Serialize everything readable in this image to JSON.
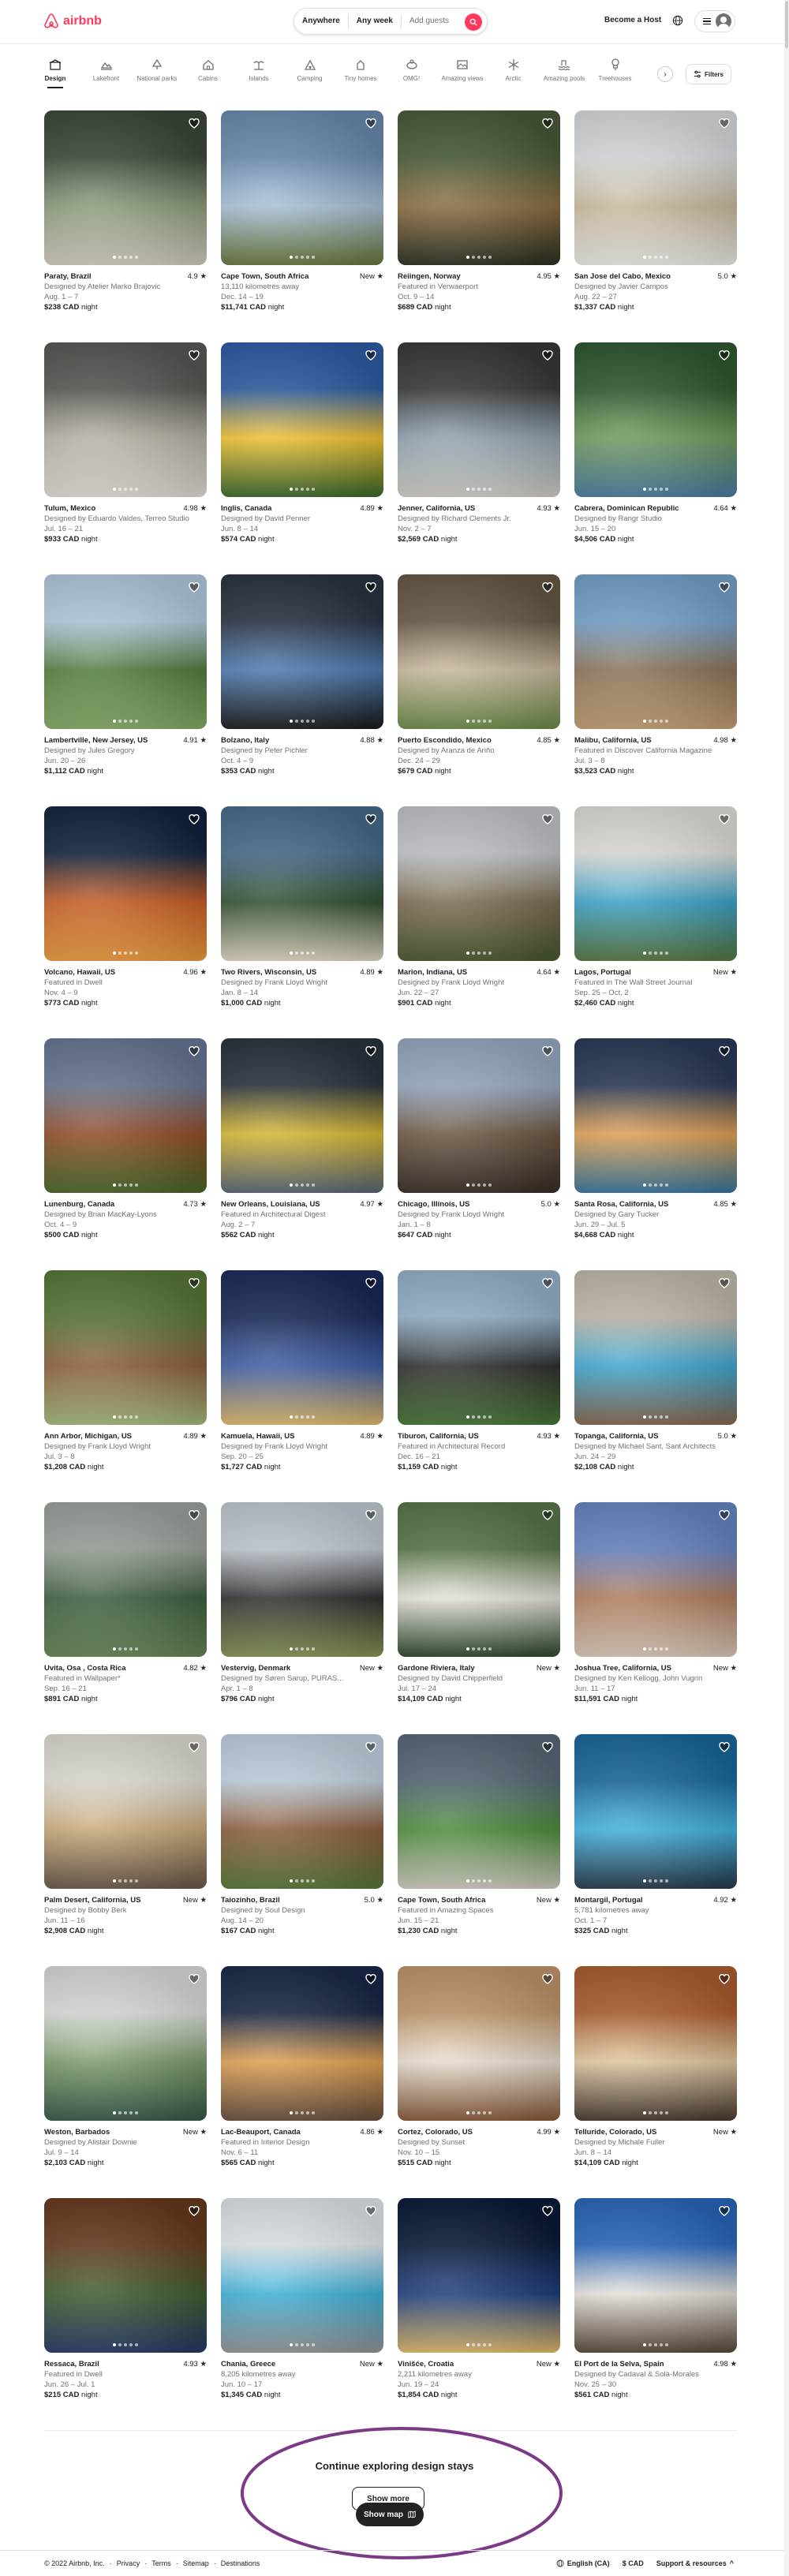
{
  "header": {
    "brand": "airbnb",
    "search": {
      "where": "Anywhere",
      "when": "Any week",
      "who": "Add guests"
    },
    "host_link": "Become a Host"
  },
  "categories": [
    {
      "label": "Design",
      "icon": "design-icon",
      "active": true
    },
    {
      "label": "Lakefront",
      "icon": "lakefront-icon"
    },
    {
      "label": "National parks",
      "icon": "national-parks-icon"
    },
    {
      "label": "Cabins",
      "icon": "cabin-icon"
    },
    {
      "label": "Islands",
      "icon": "island-icon"
    },
    {
      "label": "Camping",
      "icon": "camping-icon"
    },
    {
      "label": "Tiny homes",
      "icon": "tiny-home-icon"
    },
    {
      "label": "OMG!",
      "icon": "omg-icon"
    },
    {
      "label": "Amazing views",
      "icon": "amazing-views-icon"
    },
    {
      "label": "Arctic",
      "icon": "arctic-icon"
    },
    {
      "label": "Amazing pools",
      "icon": "pool-icon"
    },
    {
      "label": "Treehouses",
      "icon": "treehouse-icon"
    }
  ],
  "filters_label": "Filters",
  "listings": [
    {
      "location": "Paraty, Brazil",
      "rating": "4.9 ★",
      "sub": "Designed by Atelier Marko Brajovic",
      "dates": "Aug. 1 – 7",
      "price": "$238 CAD",
      "unit": "night",
      "colors": [
        "#3c4a3a",
        "#8a9a7a",
        "#d9d4c4"
      ]
    },
    {
      "location": "Cape Town, South Africa",
      "rating": "New ★",
      "sub": "13,110 kilometres away",
      "dates": "Dec. 14 – 19",
      "price": "$11,741 CAD",
      "unit": "night",
      "colors": [
        "#6d8fb3",
        "#a9c1d8",
        "#6b7a3f"
      ]
    },
    {
      "location": "Reiingen, Norway",
      "rating": "4.95 ★",
      "sub": "Featured in Verwaerport",
      "dates": "Oct. 9 – 14",
      "price": "$689 CAD",
      "unit": "night",
      "colors": [
        "#4a5d3a",
        "#8a6a3e",
        "#2d3222"
      ]
    },
    {
      "location": "San Jose del Cabo, Mexico",
      "rating": "5.0 ★",
      "sub": "Designed by Javier Campos",
      "dates": "Aug. 22 – 27",
      "price": "$1,337 CAD",
      "unit": "night",
      "colors": [
        "#dfe3e6",
        "#c9b89a",
        "#f2f2f0"
      ]
    },
    {
      "location": "Tulum, Mexico",
      "rating": "4.98 ★",
      "sub": "Designed by Eduardo Valdes, Terreo Studio",
      "dates": "Jul. 16 – 21",
      "price": "$933 CAD",
      "unit": "night",
      "colors": [
        "#5a5a55",
        "#b8b2a4",
        "#e8e4dc"
      ]
    },
    {
      "location": "Inglis, Canada",
      "rating": "4.89 ★",
      "sub": "Designed by David Penner",
      "dates": "Jun. 8 – 14",
      "price": "$574 CAD",
      "unit": "night",
      "colors": [
        "#2f5ea8",
        "#f2c12e",
        "#3d6b2e"
      ]
    },
    {
      "location": "Jenner, California, US",
      "rating": "4.93 ★",
      "sub": "Designed by Richard Clements Jr.",
      "dates": "Nov. 2 – 7",
      "price": "$2,569 CAD",
      "unit": "night",
      "colors": [
        "#3a3a3a",
        "#8fa3b0",
        "#d8d4cc"
      ]
    },
    {
      "location": "Cabrera, Dominican Republic",
      "rating": "4.64 ★",
      "sub": "Designed by Rangr Studio",
      "dates": "Jun. 15 – 20",
      "price": "$4,506 CAD",
      "unit": "night",
      "colors": [
        "#2f5a30",
        "#6f9a5a",
        "#4d7fa6"
      ]
    },
    {
      "location": "Lambertville, New Jersey, US",
      "rating": "4.91 ★",
      "sub": "Designed by Jules Gregory",
      "dates": "Jun. 20 – 26",
      "price": "$1,112 CAD",
      "unit": "night",
      "colors": [
        "#b9d1e6",
        "#4f7a3a",
        "#8ab06a"
      ]
    },
    {
      "location": "Bolzano, Italy",
      "rating": "4.88 ★",
      "sub": "Designed by Peter Pichler",
      "dates": "Oct. 4 – 9",
      "price": "$353 CAD",
      "unit": "night",
      "colors": [
        "#2a3442",
        "#4a78b0",
        "#1c1c1c"
      ]
    },
    {
      "location": "Puerto Escondido, Mexico",
      "rating": "4.85 ★",
      "sub": "Designed by Aranza de Ariño",
      "dates": "Dec. 24 – 29",
      "price": "$679 CAD",
      "unit": "night",
      "colors": [
        "#6a5a48",
        "#c9b89c",
        "#6e8f4a"
      ]
    },
    {
      "location": "Malibu, California, US",
      "rating": "4.98 ★",
      "sub": "Featured in Discover California Magazine",
      "dates": "Jul. 3 – 8",
      "price": "$3,523 CAD",
      "unit": "night",
      "colors": [
        "#7aa6d0",
        "#8a7054",
        "#c9a478"
      ]
    },
    {
      "location": "Volcano, Hawaii, US",
      "rating": "4.96 ★",
      "sub": "Featured in Dwell",
      "dates": "Nov. 4 – 9",
      "price": "$773 CAD",
      "unit": "night",
      "colors": [
        "#12253f",
        "#c65a22",
        "#f0a040"
      ]
    },
    {
      "location": "Two Rivers, Wisconsin, US",
      "rating": "4.89 ★",
      "sub": "Designed by Frank Lloyd Wright",
      "dates": "Jan. 8 – 14",
      "price": "$1,000 CAD",
      "unit": "night",
      "colors": [
        "#4a6e8f",
        "#2e4a2a",
        "#e8ddc8"
      ]
    },
    {
      "location": "Marion, Indiana, US",
      "rating": "4.64 ★",
      "sub": "Designed by Frank Lloyd Wright",
      "dates": "Jun. 22 – 27",
      "price": "$901 CAD",
      "unit": "night",
      "colors": [
        "#c7cbd0",
        "#7a6a50",
        "#4a5a30"
      ]
    },
    {
      "location": "Lagos, Portugal",
      "rating": "New ★",
      "sub": "Featured in The Wall Street Journal",
      "dates": "Sep. 25 – Oct. 2",
      "price": "$2,460 CAD",
      "unit": "night",
      "colors": [
        "#e8e6e0",
        "#3aa0c8",
        "#5a7a40"
      ]
    },
    {
      "location": "Lunenburg, Canada",
      "rating": "4.73 ★",
      "sub": "Designed by Brian MacKay-Lyons",
      "dates": "Oct. 4 – 9",
      "price": "$500 CAD",
      "unit": "night",
      "colors": [
        "#6a7a98",
        "#8f4a22",
        "#4a6a2a"
      ]
    },
    {
      "location": "New Orleans, Louisiana, US",
      "rating": "4.97 ★",
      "sub": "Featured in Architectural Digest",
      "dates": "Aug. 2 – 7",
      "price": "$562 CAD",
      "unit": "night",
      "colors": [
        "#2a3440",
        "#d8b830",
        "#5a6a78"
      ]
    },
    {
      "location": "Chicago, Illinois, US",
      "rating": "5.0 ★",
      "sub": "Designed by Frank Lloyd Wright",
      "dates": "Jan. 1 – 8",
      "price": "$647 CAD",
      "unit": "night",
      "colors": [
        "#9cb0c8",
        "#6a5440",
        "#3a3028"
      ]
    },
    {
      "location": "Santa Rosa, California, US",
      "rating": "4.85 ★",
      "sub": "Designed by Gary Tucker",
      "dates": "Jun. 29 – Jul. 5",
      "price": "$4,668 CAD",
      "unit": "night",
      "colors": [
        "#2a3a5a",
        "#e0a050",
        "#3a7aa0"
      ]
    },
    {
      "location": "Ann Arbor, Michigan, US",
      "rating": "4.89 ★",
      "sub": "Designed by Frank Lloyd Wright",
      "dates": "Jul. 3 – 8",
      "price": "$1,208 CAD",
      "unit": "night",
      "colors": [
        "#5a7a3a",
        "#8a5a3a",
        "#a8c080"
      ]
    },
    {
      "location": "Kamuela, Hawaii, US",
      "rating": "4.89 ★",
      "sub": "Designed by Frank Lloyd Wright",
      "dates": "Sep. 20 – 25",
      "price": "$1,727 CAD",
      "unit": "night",
      "colors": [
        "#1a2a5a",
        "#3a5aa0",
        "#e8c070"
      ]
    },
    {
      "location": "Tiburon, California, US",
      "rating": "4.93 ★",
      "sub": "Featured in Architectural Record",
      "dates": "Dec. 16 – 21",
      "price": "$1,159 CAD",
      "unit": "night",
      "colors": [
        "#9ab8d0",
        "#2a2a2a",
        "#4a7a3a"
      ]
    },
    {
      "location": "Topanga, California, US",
      "rating": "5.0 ★",
      "sub": "Designed by Michael Sant, Sant Architects",
      "dates": "Jun. 24 – 29",
      "price": "$2,108 CAD",
      "unit": "night",
      "colors": [
        "#c8c0b0",
        "#3aa6d0",
        "#8a6a50"
      ]
    },
    {
      "location": "Uvita, Osa , Costa Rica",
      "rating": "4.82 ★",
      "sub": "Featured in Wallpaper*",
      "dates": "Sep. 16 – 21",
      "price": "$891 CAD",
      "unit": "night",
      "colors": [
        "#a0a8a0",
        "#3a5a3a",
        "#6a8a5a"
      ]
    },
    {
      "location": "Vestervig, Denmark",
      "rating": "New ★",
      "sub": "Designed by Søren Sarup, PURAS...",
      "dates": "Apr. 1 – 8",
      "price": "$796 CAD",
      "unit": "night",
      "colors": [
        "#c8d0d8",
        "#2a2a2a",
        "#8a9a5a"
      ]
    },
    {
      "location": "Gardone Riviera, Italy",
      "rating": "New ★",
      "sub": "Designed by David Chipperfield",
      "dates": "Jul. 17 – 24",
      "price": "$14,109 CAD",
      "unit": "night",
      "colors": [
        "#5a7a4a",
        "#e8e4dc",
        "#2e4a2a"
      ]
    },
    {
      "location": "Joshua Tree, California, US",
      "rating": "New ★",
      "sub": "Designed by Ken Kellogg, John Vugrin",
      "dates": "Jun. 11 – 17",
      "price": "$11,591 CAD",
      "unit": "night",
      "colors": [
        "#6a8ac8",
        "#b07a5a",
        "#e0d0c0"
      ]
    },
    {
      "location": "Palm Desert, California, US",
      "rating": "New ★",
      "sub": "Designed by Bobby Berk",
      "dates": "Jun. 11 – 16",
      "price": "$2,908 CAD",
      "unit": "night",
      "colors": [
        "#e8e4dc",
        "#c9a878",
        "#6a5a4a"
      ]
    },
    {
      "location": "Taiozinho, Brazil",
      "rating": "5.0 ★",
      "sub": "Designed by Soul Design",
      "dates": "Aug. 14 – 20",
      "price": "$167 CAD",
      "unit": "night",
      "colors": [
        "#c8d8e8",
        "#8a5a3a",
        "#5a7a3a"
      ]
    },
    {
      "location": "Cape Town, South Africa",
      "rating": "New ★",
      "sub": "Featured in Amazing Spaces",
      "dates": "Jun. 15 – 21",
      "price": "$1,230 CAD",
      "unit": "night",
      "colors": [
        "#5a6a7a",
        "#4a8a3a",
        "#d8d0c8"
      ]
    },
    {
      "location": "Montargil, Portugal",
      "rating": "4.92 ★",
      "sub": "5,781 kilometres away",
      "dates": "Oct. 1 – 7",
      "price": "$325 CAD",
      "unit": "night",
      "colors": [
        "#1a6aa0",
        "#40b0e0",
        "#2a3a4a"
      ]
    },
    {
      "location": "Weston, Barbados",
      "rating": "New ★",
      "sub": "Designed by Alistair Downie",
      "dates": "Jul. 9 – 14",
      "price": "$2,103 CAD",
      "unit": "night",
      "colors": [
        "#e0e4e0",
        "#7a9a6a",
        "#3a5a4a"
      ]
    },
    {
      "location": "Lac-Beauport, Canada",
      "rating": "4.86 ★",
      "sub": "Featured in Interior Design",
      "dates": "Nov. 6 – 11",
      "price": "$565 CAD",
      "unit": "night",
      "colors": [
        "#1a2a4a",
        "#e0a050",
        "#6a5040"
      ]
    },
    {
      "location": "Cortez, Colorado, US",
      "rating": "4.99 ★",
      "sub": "Designed by Sunset",
      "dates": "Nov. 10 – 15",
      "price": "$515 CAD",
      "unit": "night",
      "colors": [
        "#c89a70",
        "#e8e0d0",
        "#8a5a3a"
      ]
    },
    {
      "location": "Telluride, Colorado, US",
      "rating": "New ★",
      "sub": "Designed by Michale Fuller",
      "dates": "Jun. 8 – 14",
      "price": "$14,109 CAD",
      "unit": "night",
      "colors": [
        "#b06030",
        "#e0c8a0",
        "#4a3a30"
      ]
    },
    {
      "location": "Ressaca, Brazil",
      "rating": "4.93 ★",
      "sub": "Featured in Dwell",
      "dates": "Jun. 26 – Jul. 1",
      "price": "$215 CAD",
      "unit": "night",
      "colors": [
        "#6a3a20",
        "#3a5a2a",
        "#2a3a6a"
      ]
    },
    {
      "location": "Chania, Greece",
      "rating": "New ★",
      "sub": "8,205 kilometres away",
      "dates": "Jun. 10 – 17",
      "price": "$1,345 CAD",
      "unit": "night",
      "colors": [
        "#e8eef4",
        "#3ab0d8",
        "#9a9a9a"
      ]
    },
    {
      "location": "Vinišće, Croatia",
      "rating": "New ★",
      "sub": "2,211 kilometres away",
      "dates": "Jun. 19 – 24",
      "price": "$1,854 CAD",
      "unit": "night",
      "colors": [
        "#0a1a3a",
        "#1a3a7a",
        "#e8c070"
      ]
    },
    {
      "location": "El Port de la Selva, Spain",
      "rating": "4.98 ★",
      "sub": "Designed by Cadaval & Solà-Morales",
      "dates": "Nov. 25 – 30",
      "price": "$561 CAD",
      "unit": "night",
      "colors": [
        "#2a6ac0",
        "#e8e4dc",
        "#5a4a3a"
      ]
    }
  ],
  "continue": {
    "heading": "Continue exploring design stays",
    "show_more": "Show more",
    "show_map": "Show map"
  },
  "footer": {
    "left": [
      "© 2022 Airbnb, Inc.",
      "·",
      "Privacy",
      "·",
      "Terms",
      "·",
      "Sitemap",
      "·",
      "Destinations"
    ],
    "language": "English (CA)",
    "currency": "$ CAD",
    "support": "Support & resources"
  },
  "colors": {
    "brand": "#ff385c",
    "text": "#222222",
    "muted": "#717171",
    "annotation": "#7a3a86"
  }
}
